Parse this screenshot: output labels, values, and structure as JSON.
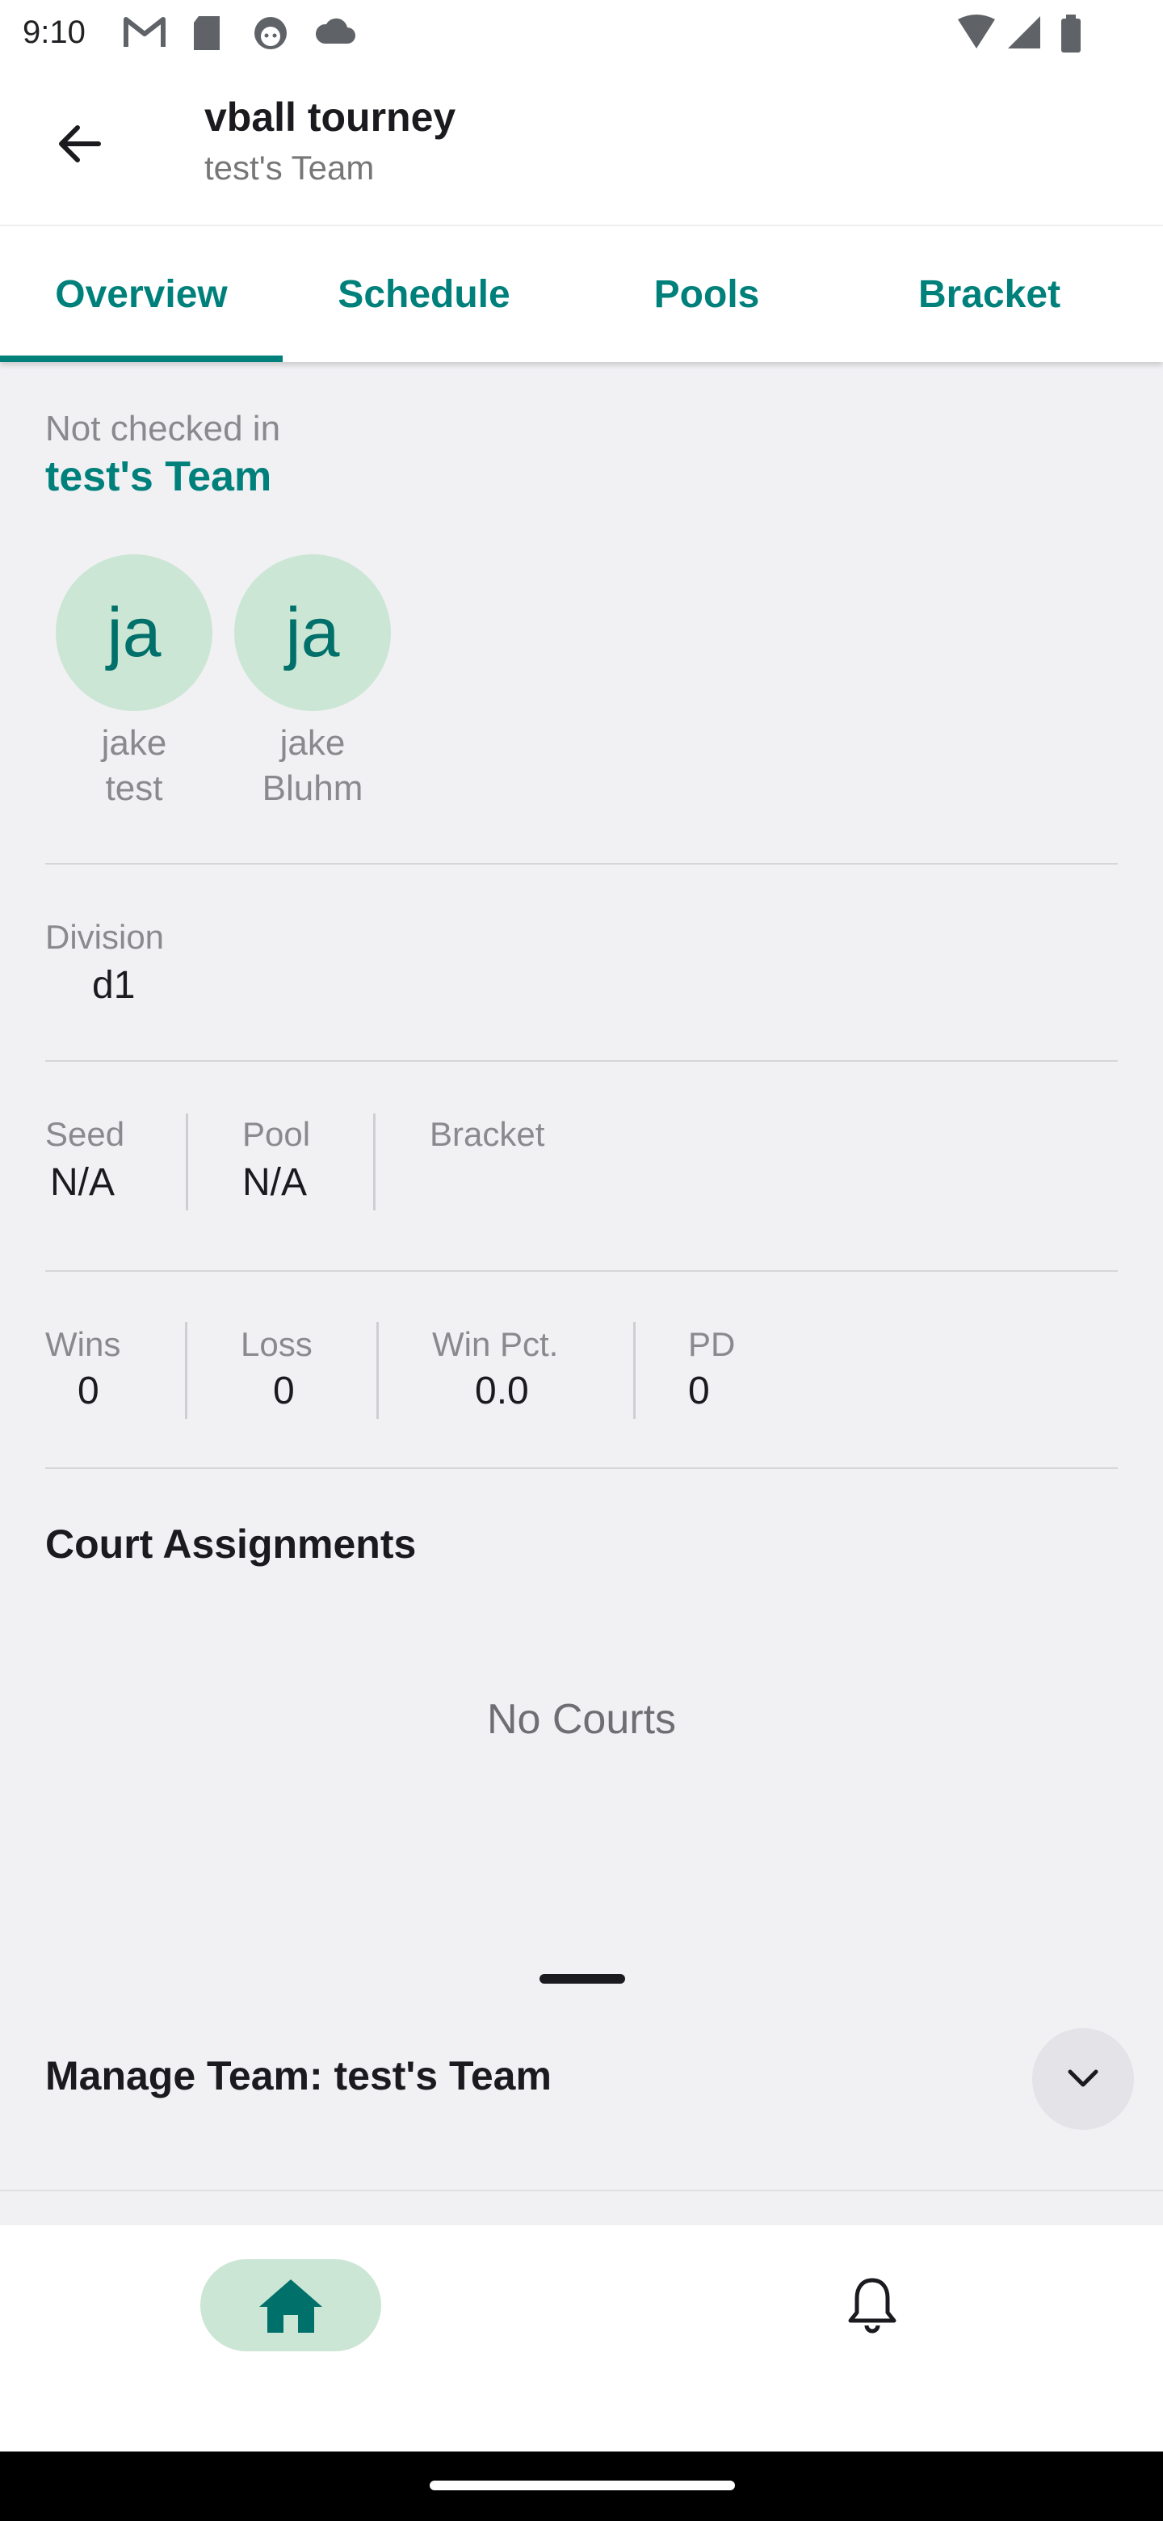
{
  "status_bar": {
    "time": "9:10",
    "icons_left": [
      "gmail-icon",
      "sd-card-icon",
      "face-icon",
      "cloud-icon"
    ],
    "icons_right": [
      "wifi-icon",
      "signal-icon",
      "battery-icon"
    ]
  },
  "app_bar": {
    "title": "vball tourney",
    "subtitle": "test's Team"
  },
  "tabs": [
    {
      "label": "Overview",
      "selected": true
    },
    {
      "label": "Schedule",
      "selected": false
    },
    {
      "label": "Pools",
      "selected": false
    },
    {
      "label": "Bracket",
      "selected": false
    }
  ],
  "team": {
    "check_in_status": "Not checked in",
    "name": "test's Team",
    "players": [
      {
        "initials": "ja",
        "first": "jake",
        "last": "test"
      },
      {
        "initials": "ja",
        "first": "jake",
        "last": "Bluhm"
      }
    ]
  },
  "division": {
    "label": "Division",
    "value": "d1"
  },
  "seeding": {
    "seed_label": "Seed",
    "seed_value": "N/A",
    "pool_label": "Pool",
    "pool_value": "N/A",
    "bracket_label": "Bracket",
    "bracket_value": ""
  },
  "record": {
    "wins_label": "Wins",
    "wins": "0",
    "loss_label": "Loss",
    "loss": "0",
    "pct_label": "Win Pct.",
    "pct": "0.0",
    "pd_label": "PD",
    "pd": "0"
  },
  "court_assignments": {
    "heading": "Court Assignments",
    "empty_text": "No Courts"
  },
  "bottom_sheet": {
    "title": "Manage Team: test's Team"
  },
  "bottom_nav": {
    "items": [
      {
        "icon": "home-icon",
        "selected": true
      },
      {
        "icon": "bell-icon",
        "selected": false
      }
    ]
  },
  "colors": {
    "accent": "#00807A",
    "avatar_bg": "#CCE6D5",
    "background": "#F1F1F4"
  }
}
